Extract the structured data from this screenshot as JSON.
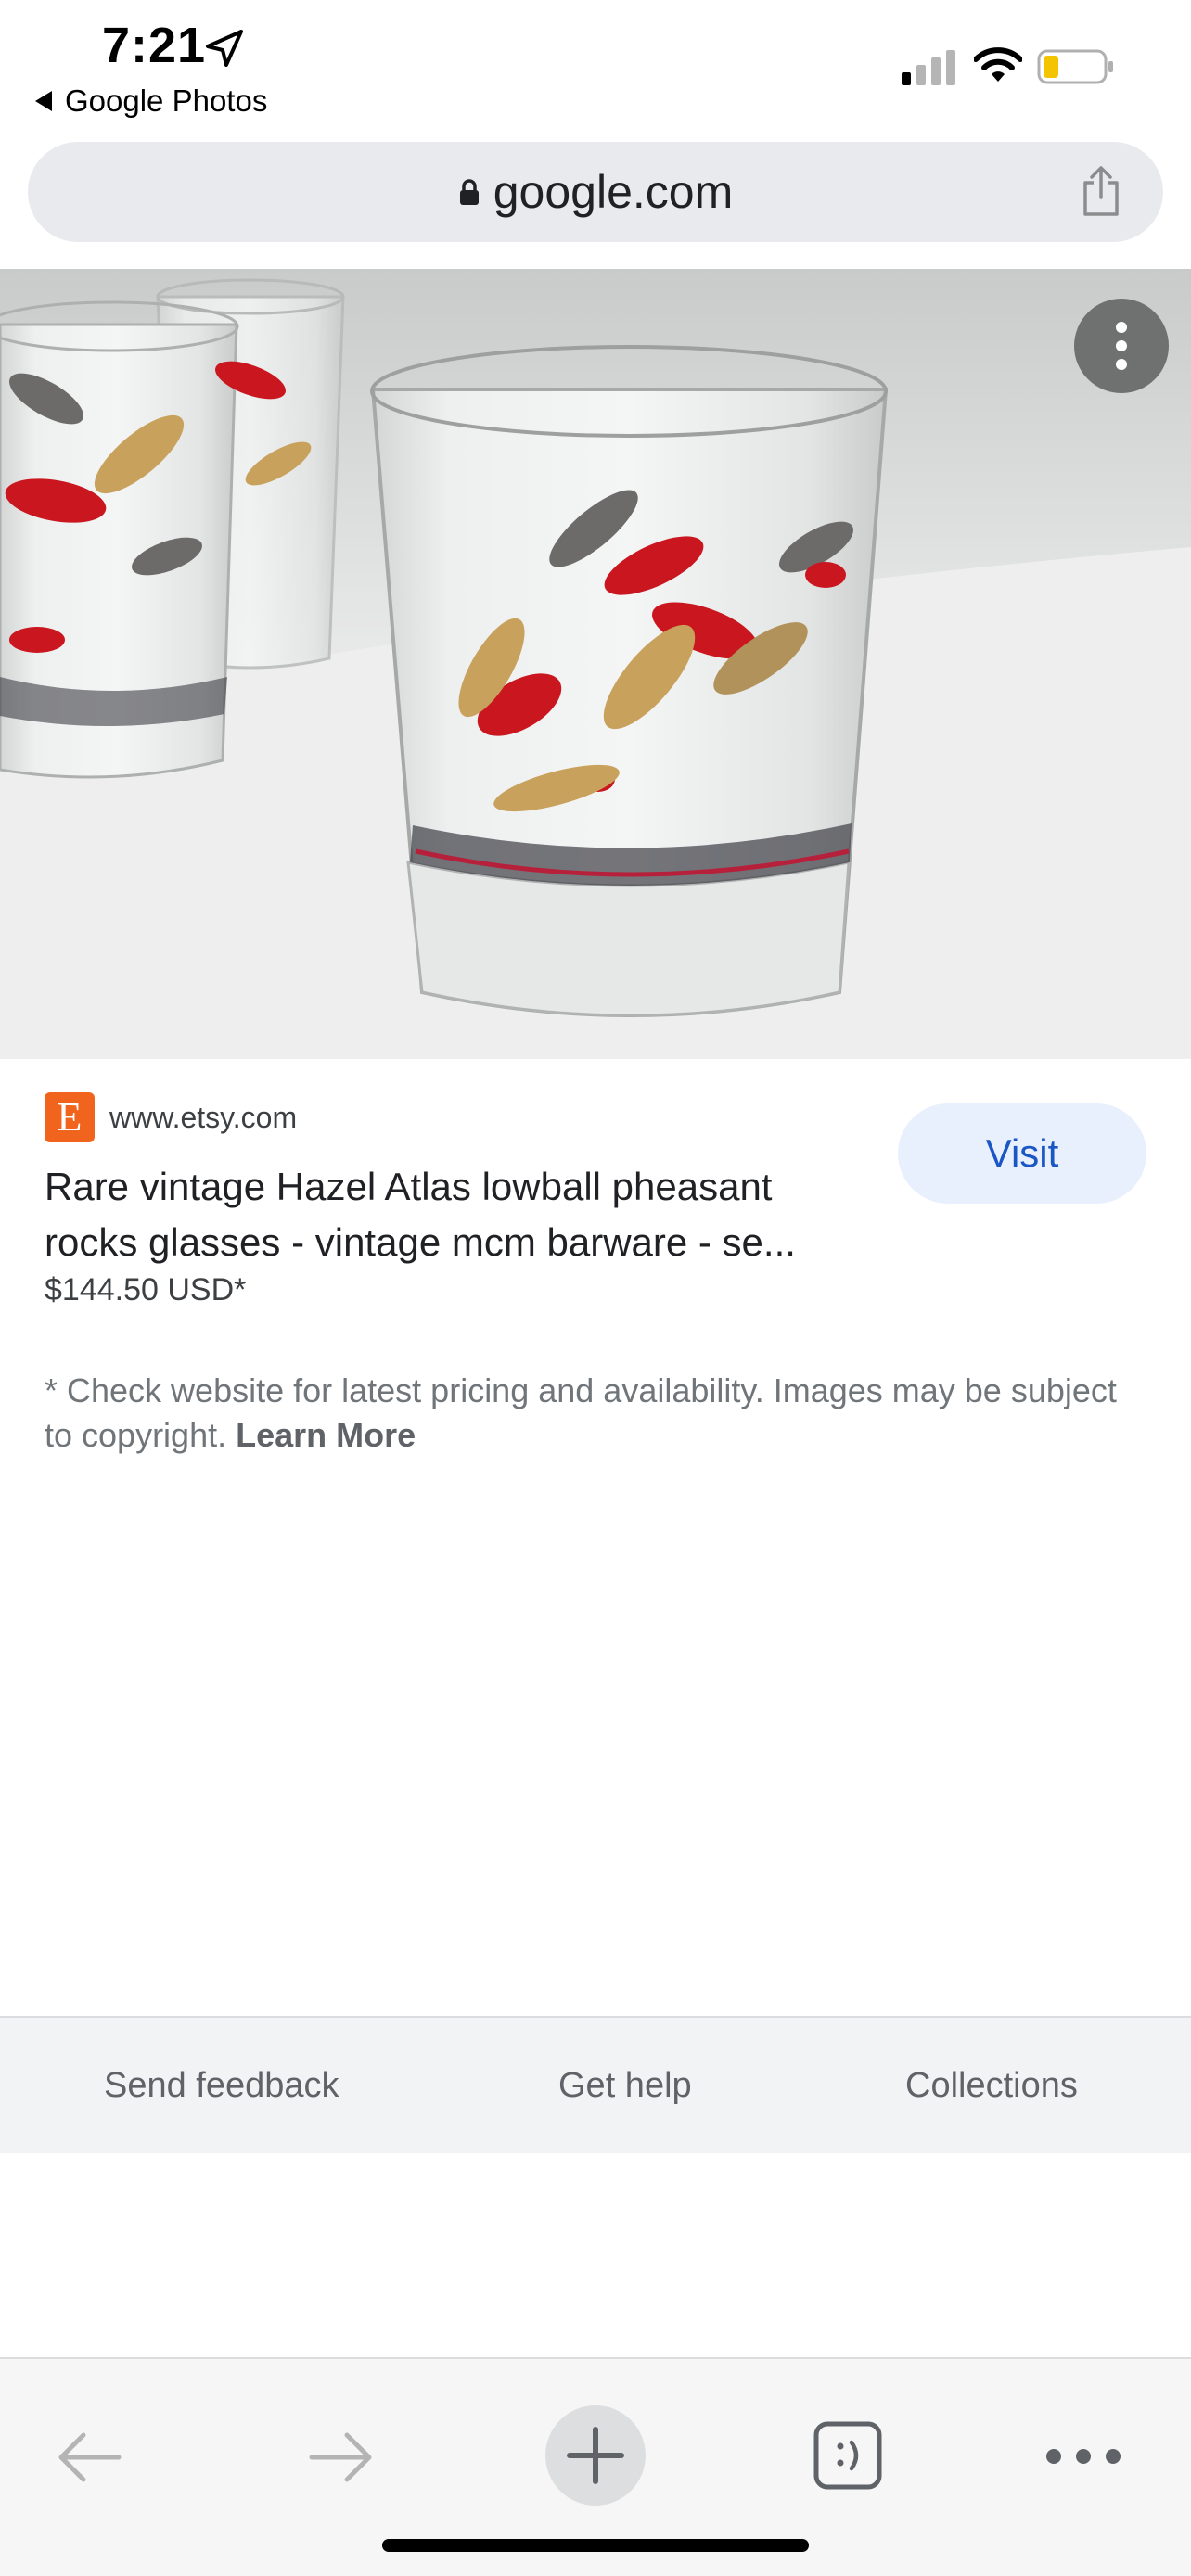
{
  "status_bar": {
    "time": "7:21",
    "back_app": "Google Photos"
  },
  "browser": {
    "url": "google.com"
  },
  "result": {
    "source_site": "www.etsy.com",
    "source_logo_letter": "E",
    "title": "Rare vintage Hazel Atlas lowball pheasant rocks glasses - vintage mcm barware - se...",
    "price": "$144.50 USD*",
    "visit_label": "Visit",
    "disclaimer": "* Check website for latest pricing and availability. Images may be subject to copyright.",
    "learn_more_label": "Learn More"
  },
  "footer": {
    "links": [
      "Send feedback",
      "Get help",
      "Collections"
    ]
  },
  "colors": {
    "etsy_orange": "#f1641e",
    "visit_bg": "#e8f0fe",
    "visit_text": "#1a56c4",
    "battery_level": "#f5c400"
  },
  "icons": [
    "location-arrow-icon",
    "signal-icon",
    "wifi-icon",
    "battery-icon",
    "lock-icon",
    "share-icon",
    "more-vert-icon",
    "back-arrow-icon",
    "forward-arrow-icon",
    "new-tab-icon",
    "tabs-icon",
    "menu-dots-icon"
  ]
}
